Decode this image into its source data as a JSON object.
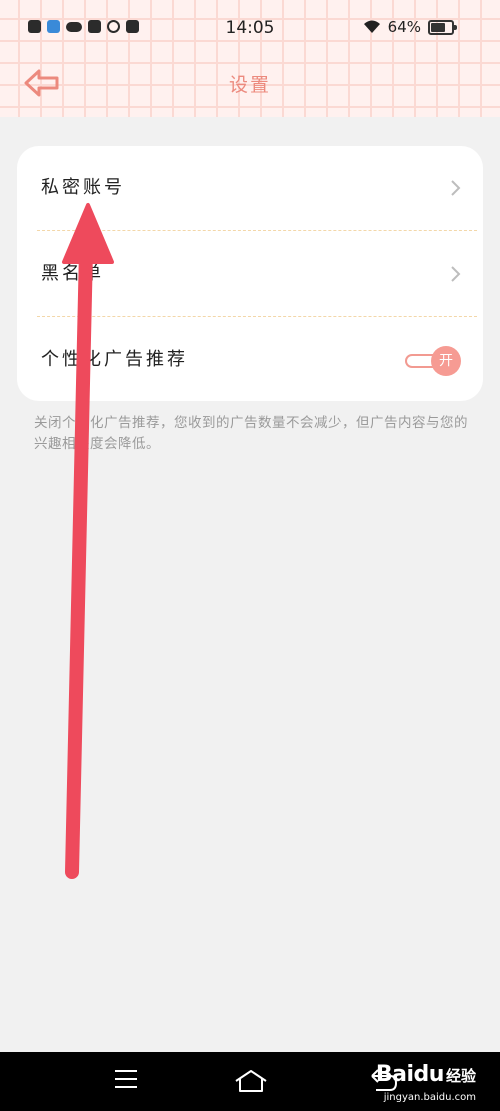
{
  "status_bar": {
    "time": "14:05",
    "battery_percent": "64%",
    "battery_level": 0.64
  },
  "header": {
    "title": "设置",
    "back_icon": "back-arrow-icon"
  },
  "settings": {
    "items": [
      {
        "label": "私密账号",
        "type": "link"
      },
      {
        "label": "黑名单",
        "type": "link"
      },
      {
        "label": "个性化广告推荐",
        "type": "toggle",
        "toggle_text": "开",
        "enabled": true
      }
    ],
    "hint": "关闭个性化广告推荐，您收到的广告数量不会减少，但广告内容与您的兴趣相关度会降低。"
  },
  "colors": {
    "accent": "#ec8a7e",
    "annotation_arrow": "#ee4a5c",
    "separator": "#f3d7a9"
  },
  "bottom_nav": {
    "icons": [
      "menu-icon",
      "home-icon",
      "back-icon"
    ]
  },
  "watermark": {
    "logo": "Baidu",
    "text": "经验",
    "url": "jingyan.baidu.com"
  }
}
